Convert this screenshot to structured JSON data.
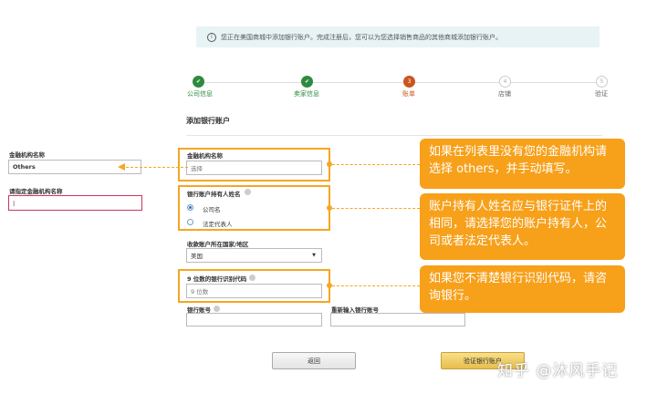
{
  "banner": {
    "text": "您正在美国商城中添加银行账户。完成注册后，您可以为您选择销售商品的其他商城添加银行账户。",
    "icon": "info-icon"
  },
  "steps": [
    {
      "label": "公司信息",
      "status": "done"
    },
    {
      "label": "卖家信息",
      "status": "done"
    },
    {
      "label": "账单",
      "num": "3",
      "status": "current"
    },
    {
      "label": "店铺",
      "num": "4",
      "status": "todo"
    },
    {
      "label": "验证",
      "num": "5",
      "status": "todo"
    }
  ],
  "form": {
    "title": "添加银行账户",
    "institution_label": "金融机构名称",
    "institution_placeholder": "选择",
    "holder_label": "银行账户持有人姓名",
    "holder_options": [
      "公司名",
      "法定代表人"
    ],
    "country_label": "收款账户所在国家/地区",
    "country_value": "美国",
    "routing_label": "9 位数的银行识别代码",
    "routing_placeholder": "9 位数",
    "account_label": "银行账号",
    "account_confirm_label": "重新输入银行账号",
    "back_button": "返回",
    "verify_button": "验证银行账户"
  },
  "side": {
    "institution_label": "金融机构名称",
    "institution_value": "Others",
    "specify_label": "请指定金融机构名称"
  },
  "callouts": [
    "如果在列表里没有您的金融机构请选择 others，并手动填写。",
    "账户持有人姓名应与银行证件上的相同，请选择您的账户持有人，公司或者法定代表人。",
    "如果您不清楚银行识别代码，请咨询银行。"
  ],
  "watermark": "知乎 @沐风手记",
  "colors": {
    "accent": "#f7a01a",
    "done": "#2e8b3e",
    "current": "#c9561e"
  }
}
